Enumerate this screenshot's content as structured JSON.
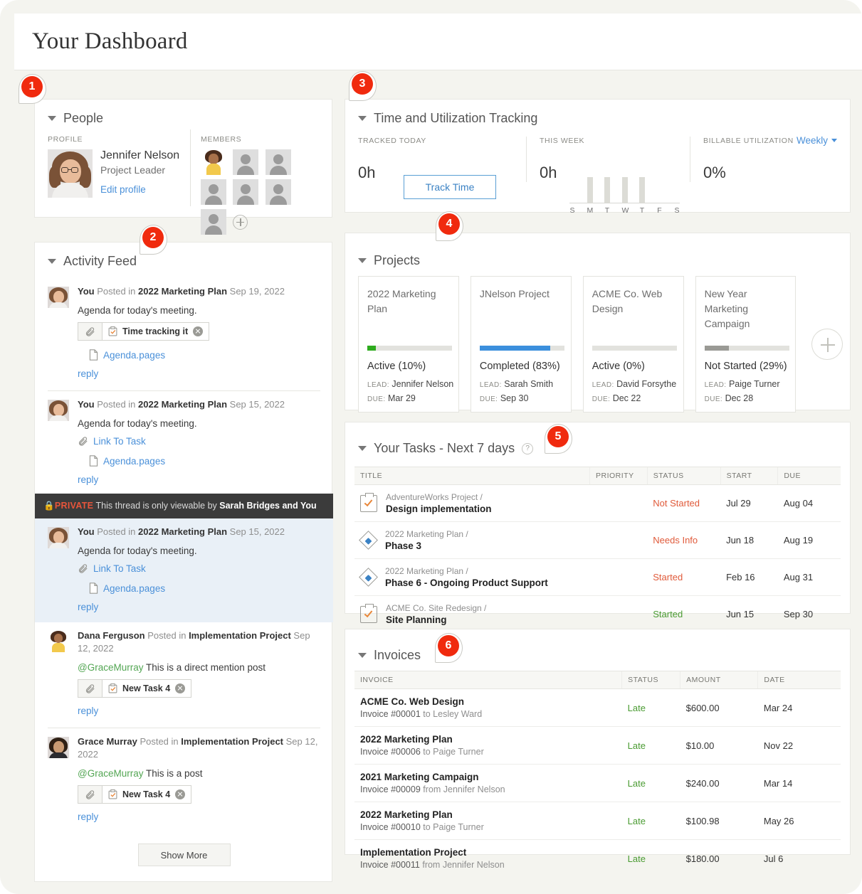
{
  "header": {
    "title": "Your Dashboard"
  },
  "pins": [
    {
      "n": "1"
    },
    {
      "n": "2"
    },
    {
      "n": "3"
    },
    {
      "n": "4"
    },
    {
      "n": "5"
    },
    {
      "n": "6"
    }
  ],
  "people": {
    "title": "People",
    "profile_label": "PROFILE",
    "members_label": "MEMBERS",
    "name": "Jennifer Nelson",
    "role": "Project Leader",
    "edit_link": "Edit profile",
    "member_count": 7,
    "add_member_label": "+"
  },
  "activity": {
    "title": "Activity Feed",
    "show_more": "Show More",
    "private_banner": {
      "tag": "PRIVATE",
      "text": "This thread is only viewable by ",
      "who": "Sarah Bridges and You"
    },
    "posts": [
      {
        "author": "You",
        "verb": " Posted in ",
        "project": "2022 Marketing Plan",
        "date": " Sep 19, 2022",
        "text": "Agenda for today's meeting.",
        "chip": "Time tracking it",
        "file": "Agenda.pages",
        "reply": "reply"
      },
      {
        "author": "You",
        "verb": " Posted in ",
        "project": "2022 Marketing Plan",
        "date": " Sep 15, 2022",
        "text": "Agenda for today's meeting.",
        "link": "Link To Task",
        "file": "Agenda.pages",
        "reply": "reply"
      },
      {
        "author": "You",
        "verb": " Posted in ",
        "project": "2022 Marketing Plan",
        "date": " Sep 15, 2022",
        "text": "Agenda for today's meeting.",
        "link": "Link To Task",
        "file": "Agenda.pages",
        "reply": "reply"
      },
      {
        "author": "Dana Ferguson",
        "verb": " Posted in ",
        "project": "Implementation Project",
        "date": " Sep 12, 2022",
        "mention": "@GraceMurray",
        "text": " This is a direct mention post",
        "chip": "New Task 4",
        "reply": "reply"
      },
      {
        "author": "Grace Murray",
        "verb": " Posted in ",
        "project": "Implementation Project",
        "date": " Sep 12, 2022",
        "mention": "@GraceMurray",
        "text": " This is a post",
        "chip": "New Task 4",
        "reply": "reply"
      }
    ]
  },
  "time": {
    "title": "Time and Utilization Tracking",
    "tracked_today_label": "TRACKED TODAY",
    "tracked_today_value": "0h",
    "track_button": "Track Time",
    "this_week_label": "THIS WEEK",
    "this_week_value": "0h",
    "billable_label": "BILLABLE UTILIZATION",
    "billable_value": "0%",
    "period_select": "Weekly"
  },
  "chart_data": {
    "type": "bar",
    "title": "This Week",
    "categories": [
      "S",
      "M",
      "T",
      "W",
      "T",
      "F",
      "S"
    ],
    "values": [
      0,
      1,
      1,
      1,
      1,
      0,
      0
    ],
    "xlabel": "",
    "ylabel": "",
    "ylim": [
      0,
      1.2
    ],
    "grid": false,
    "legend": "none",
    "bar_color": "#dcdcd6"
  },
  "projects": {
    "title": "Projects",
    "lead_key": "LEAD:",
    "due_key": "DUE:",
    "add_label": "+",
    "items": [
      {
        "name": "2022 Marketing Plan",
        "percent": 10,
        "status": "Active (10%)",
        "color": "#2eab1e",
        "lead": "Jennifer Nelson",
        "due": "Mar 29"
      },
      {
        "name": "JNelson Project",
        "percent": 83,
        "status": "Completed (83%)",
        "color": "#3b8fdd",
        "lead": "Sarah Smith",
        "due": "Sep 30"
      },
      {
        "name": "ACME Co. Web Design",
        "percent": 0,
        "status": "Active (0%)",
        "color": "#e2e2de",
        "lead": "David Forsythe",
        "due": "Dec 22"
      },
      {
        "name": "New Year Marketing Campaign",
        "percent": 29,
        "status": "Not Started (29%)",
        "color": "#9a9a95",
        "lead": "Paige Turner",
        "due": "Dec 28"
      }
    ]
  },
  "tasks": {
    "title": "Your Tasks - Next 7 days",
    "help": "?",
    "columns": [
      "TITLE",
      "PRIORITY",
      "STATUS",
      "START",
      "DUE"
    ],
    "rows": [
      {
        "icon": "clipboard-check-icon",
        "project": "AdventureWorks Project /",
        "name": "Design implementation",
        "priority": "",
        "status": "Not Started",
        "status_color": "red",
        "start": "Jul 29",
        "due": "Aug 04"
      },
      {
        "icon": "milestone-diamond-icon",
        "project": "2022 Marketing Plan /",
        "name": "Phase 3",
        "priority": "",
        "status": "Needs Info",
        "status_color": "red",
        "start": "Jun 18",
        "due": "Aug 19"
      },
      {
        "icon": "milestone-diamond-icon",
        "project": "2022 Marketing Plan /",
        "name": "Phase 6 - Ongoing Product Support",
        "priority": "",
        "status": "Started",
        "status_color": "red",
        "start": "Feb 16",
        "due": "Aug 31"
      },
      {
        "icon": "clipboard-check-icon",
        "project": "ACME Co. Site Redesign /",
        "name": "Site Planning",
        "priority": "",
        "status": "Started",
        "status_color": "green",
        "start": "Jun 15",
        "due": "Sep 30"
      }
    ]
  },
  "invoices": {
    "title": "Invoices",
    "columns": [
      "INVOICE",
      "STATUS",
      "AMOUNT",
      "DATE"
    ],
    "rows": [
      {
        "name": "ACME Co. Web Design",
        "number": "Invoice #00001",
        "party": " to Lesley Ward",
        "status": "Late",
        "amount": "$600.00",
        "date": "Mar 24"
      },
      {
        "name": "2022 Marketing Plan",
        "number": "Invoice #00006",
        "party": " to Paige Turner",
        "status": "Late",
        "amount": "$10.00",
        "date": "Nov 22"
      },
      {
        "name": "2021 Marketing Campaign",
        "number": "Invoice #00009",
        "party": " from Jennifer Nelson",
        "status": "Late",
        "amount": "$240.00",
        "date": "Mar 14"
      },
      {
        "name": "2022 Marketing Plan",
        "number": "Invoice #00010",
        "party": " to Paige Turner",
        "status": "Late",
        "amount": "$100.98",
        "date": "May 26"
      },
      {
        "name": "Implementation Project",
        "number": "Invoice #00011",
        "party": " from Jennifer Nelson",
        "status": "Late",
        "amount": "$180.00",
        "date": "Jul 6"
      }
    ]
  },
  "colors": {
    "accent_red": "#f02a0e",
    "link_blue": "#4a90d9",
    "status_green": "#4a9b32",
    "status_red": "#e05a3a",
    "page_bg": "#f4f4ef"
  }
}
